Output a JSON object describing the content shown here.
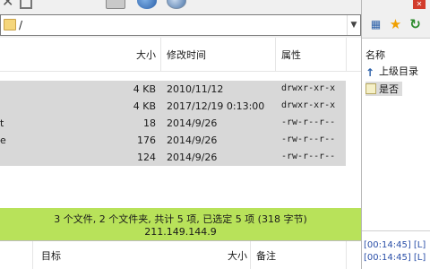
{
  "path": {
    "value": "/"
  },
  "columns": {
    "size": "大小",
    "modified": "修改时间",
    "attributes": "属性"
  },
  "files": [
    {
      "name": "",
      "size": "4 KB",
      "modified": "2010/11/12",
      "attributes": "drwxr-xr-x"
    },
    {
      "name": "",
      "size": "4 KB",
      "modified": "2017/12/19 0:13:00",
      "attributes": "drwxr-xr-x"
    },
    {
      "name": "t",
      "size": "18",
      "modified": "2014/9/26",
      "attributes": "-rw-r--r--"
    },
    {
      "name": "e",
      "size": "176",
      "modified": "2014/9/26",
      "attributes": "-rw-r--r--"
    },
    {
      "name": "",
      "size": "124",
      "modified": "2014/9/26",
      "attributes": "-rw-r--r--"
    }
  ],
  "status": {
    "summary": "3 个文件, 2 个文件夹, 共计 5 项, 已选定 5 项 (318 字节)",
    "host": "211.149.144.9"
  },
  "queue": {
    "target": "目标",
    "size": "大小",
    "note": "备注"
  },
  "right_panel": {
    "name_header": "名称",
    "items": [
      {
        "label": "上级目录",
        "icon": "up-arrow-icon"
      },
      {
        "label": "是否",
        "icon": "file-icon"
      }
    ],
    "log": [
      "[00:14:45] [L]",
      "[00:14:45] [L]"
    ]
  }
}
